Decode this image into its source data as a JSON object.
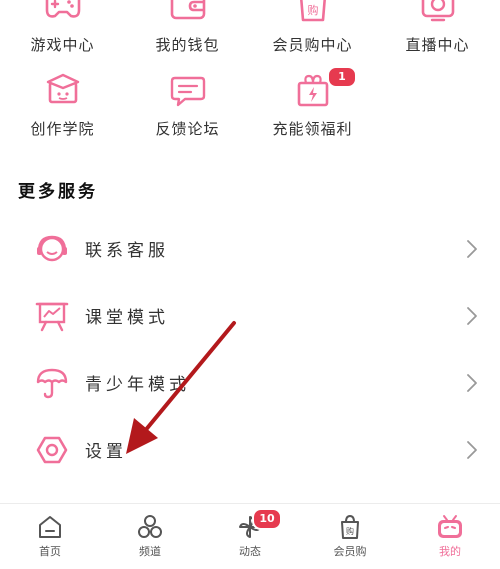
{
  "colors": {
    "accent": "#f06f99",
    "badge": "#e63a4f",
    "arrow": "#b3191c"
  },
  "grid_row1": [
    {
      "label": "游戏中心",
      "icon": "gamepad-icon"
    },
    {
      "label": "我的钱包",
      "icon": "wallet-icon"
    },
    {
      "label": "会员购中心",
      "icon": "shopping-bag-icon"
    },
    {
      "label": "直播中心",
      "icon": "live-tv-icon"
    }
  ],
  "grid_row2": [
    {
      "label": "创作学院",
      "icon": "graduation-cap-icon"
    },
    {
      "label": "反馈论坛",
      "icon": "chat-bubble-icon"
    },
    {
      "label": "充能领福利",
      "icon": "gift-box-icon",
      "badge": "1"
    }
  ],
  "more_services": {
    "title": "更多服务",
    "items": [
      {
        "label": "联系客服",
        "icon": "headset-icon"
      },
      {
        "label": "课堂模式",
        "icon": "presentation-board-icon"
      },
      {
        "label": "青少年模式",
        "icon": "umbrella-icon"
      },
      {
        "label": "设置",
        "icon": "settings-hexagon-icon"
      }
    ]
  },
  "bottom_nav": [
    {
      "label": "首页",
      "icon": "home-icon"
    },
    {
      "label": "频道",
      "icon": "channels-icon"
    },
    {
      "label": "动态",
      "icon": "pinwheel-icon",
      "badge": "10"
    },
    {
      "label": "会员购",
      "icon": "shopping-bag-icon"
    },
    {
      "label": "我的",
      "icon": "tv-mascot-icon",
      "active": true
    }
  ]
}
